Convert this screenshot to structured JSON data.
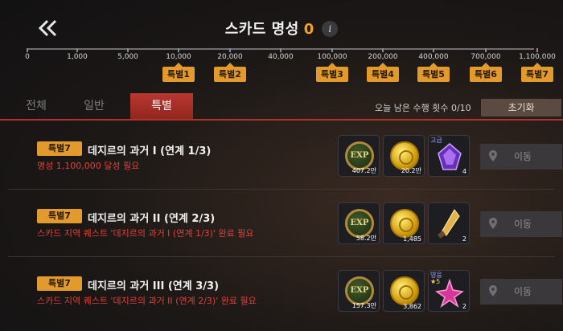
{
  "header": {
    "title": "스카드 명성",
    "fame_value": "0",
    "info_glyph": "i"
  },
  "scale": [
    "0",
    "1,000",
    "5,000",
    "10,000",
    "20,000",
    "40,000",
    "100,000",
    "200,000",
    "400,000",
    "700,000",
    "1,100,000"
  ],
  "markers": [
    "특별1",
    "특별2",
    "특별3",
    "특별4",
    "특별5",
    "특별6",
    "특별7"
  ],
  "tabs": [
    "전체",
    "일반",
    "특별"
  ],
  "active_tab": "특별",
  "daily": {
    "remaining_label": "오늘 남은 수행 횟수",
    "remaining_value": "0/10",
    "reset_label": "초기화"
  },
  "quests": [
    {
      "badge": "특별7",
      "title": "데지르의 과거 I (연계 1/3)",
      "requirement": "명성 1,100,000 달성 필요",
      "rewards": [
        {
          "icon": "exp-icon",
          "label": "EXP",
          "qty": "407.2만"
        },
        {
          "icon": "gold-coin-icon",
          "qty": "20.2만"
        },
        {
          "icon": "purple-crystal-icon",
          "tag": "고급",
          "qty": "4"
        }
      ],
      "action": "이동"
    },
    {
      "badge": "특별7",
      "title": "데지르의 과거 II (연계 2/3)",
      "requirement": "스카드 지역 퀘스트 '데지르의 과거 I (연계 1/3)' 완료 필요",
      "rewards": [
        {
          "icon": "exp-icon",
          "label": "EXP",
          "qty": "58.2만"
        },
        {
          "icon": "gold-coin-icon",
          "qty": "1,485"
        },
        {
          "icon": "spearhead-icon",
          "qty": "2"
        }
      ],
      "action": "이동"
    },
    {
      "badge": "특별7",
      "title": "데지르의 과거 III (연계 3/3)",
      "requirement": "스카드 지역 퀘스트 '데지르의 과거 II (연계 2/3)' 완료 필요",
      "rewards": [
        {
          "icon": "exp-icon",
          "label": "EXP",
          "qty": "157.3만"
        },
        {
          "icon": "gold-coin-icon",
          "qty": "3,862"
        },
        {
          "icon": "pink-star-icon",
          "tag": "영웅",
          "stars": "★5",
          "qty": "2"
        }
      ],
      "action": "이동"
    }
  ],
  "colors": {
    "accent_orange": "#e39a2c",
    "tab_active_red": "#b83830",
    "requirement_red": "#e0403a"
  }
}
